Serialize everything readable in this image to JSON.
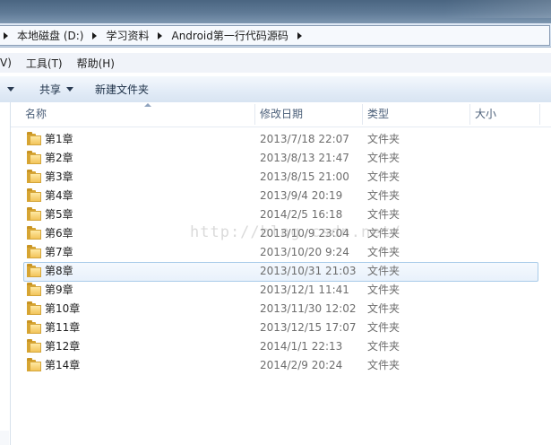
{
  "address": {
    "crumbs": [
      "本地磁盘 (D:)",
      "学习资料",
      "Android第一行代码源码"
    ]
  },
  "menu": {
    "partial_left": "V)",
    "tools": "工具(T)",
    "help": "帮助(H)"
  },
  "commands": {
    "share": "共享",
    "new_folder": "新建文件夹"
  },
  "columns": {
    "name": "名称",
    "modified": "修改日期",
    "type": "类型",
    "size": "大小"
  },
  "rows": [
    {
      "name": "第1章",
      "date": "2013/7/18 22:07",
      "type": "文件夹"
    },
    {
      "name": "第2章",
      "date": "2013/8/13 21:47",
      "type": "文件夹"
    },
    {
      "name": "第3章",
      "date": "2013/8/15 21:00",
      "type": "文件夹"
    },
    {
      "name": "第4章",
      "date": "2013/9/4 20:19",
      "type": "文件夹"
    },
    {
      "name": "第5章",
      "date": "2014/2/5 16:18",
      "type": "文件夹"
    },
    {
      "name": "第6章",
      "date": "2013/10/9 23:04",
      "type": "文件夹"
    },
    {
      "name": "第7章",
      "date": "2013/10/20 9:24",
      "type": "文件夹"
    },
    {
      "name": "第8章",
      "date": "2013/10/31 21:03",
      "type": "文件夹",
      "selected": true
    },
    {
      "name": "第9章",
      "date": "2013/12/1 11:41",
      "type": "文件夹"
    },
    {
      "name": "第10章",
      "date": "2013/11/30 12:02",
      "type": "文件夹"
    },
    {
      "name": "第11章",
      "date": "2013/12/15 17:07",
      "type": "文件夹"
    },
    {
      "name": "第12章",
      "date": "2014/1/1 22:13",
      "type": "文件夹"
    },
    {
      "name": "第14章",
      "date": "2014/2/9 20:24",
      "type": "文件夹"
    }
  ],
  "watermark": "http://blog.csdn.net/",
  "icons": {
    "folder": "folder-icon",
    "crumb_separator": "chevron-right-icon",
    "dropdown": "chevron-down-icon",
    "sort": "sort-ascending-icon"
  }
}
